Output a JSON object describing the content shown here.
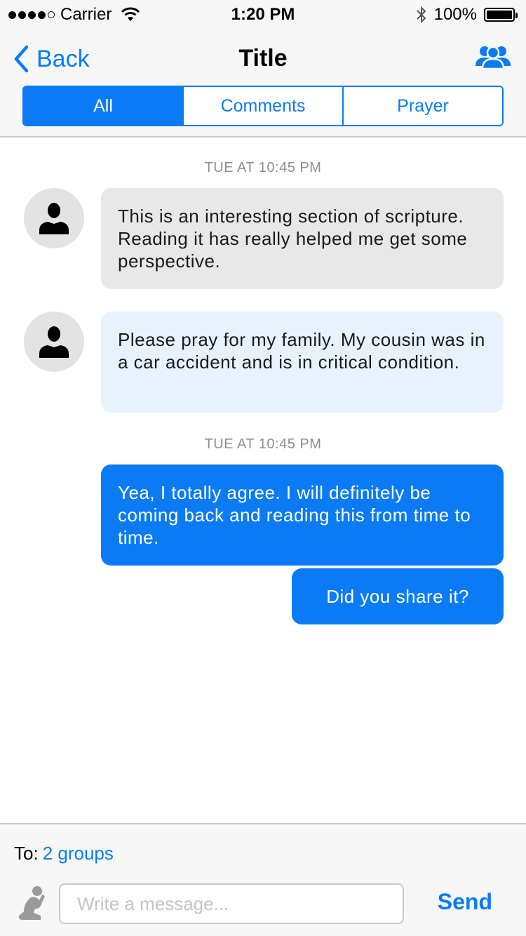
{
  "status_bar": {
    "carrier": "Carrier",
    "time": "1:20 PM",
    "battery": "100%",
    "icons": [
      "signal-dots-icon",
      "wifi-icon",
      "bluetooth-icon",
      "battery-icon"
    ]
  },
  "nav": {
    "back_label": "Back",
    "title": "Title",
    "groups_icon": "group-people-icon"
  },
  "tabs": [
    {
      "label": "All",
      "active": true
    },
    {
      "label": "Comments",
      "active": false
    },
    {
      "label": "Prayer",
      "active": false
    }
  ],
  "messages": {
    "timestamp_1": "TUE AT 10:45 PM",
    "comment_1": "This is an interesting section of scripture. Reading it has really helped me get some perspective.",
    "prayer_1": "Please pray for my family. My cousin was in a car accident and is in critical condition.",
    "timestamp_2": "TUE AT 10:45 PM",
    "outgoing_1": "Yea, I totally agree. I will definitely be coming back and reading this from time to time.",
    "outgoing_2": "Did you share it?"
  },
  "composer": {
    "to_label": "To:",
    "to_value": "2 groups",
    "placeholder": "Write a message...",
    "send_label": "Send",
    "prayer_icon": "praying-person-icon"
  },
  "colors": {
    "accent": "#0a7bf5",
    "incoming_comment_bg": "#e8e8e8",
    "incoming_prayer_bg": "#e7f2fd",
    "bar_bg": "#f7f7f7"
  }
}
